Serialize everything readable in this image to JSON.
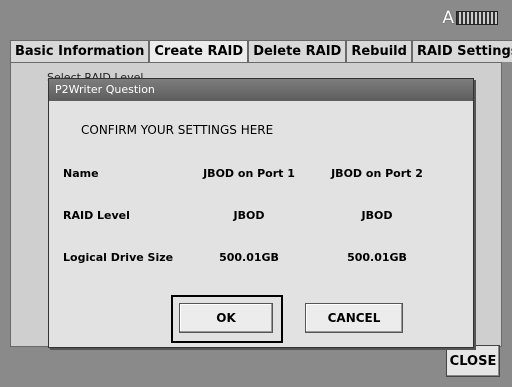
{
  "header": {
    "indicator_letter": "A",
    "battery_icon": "battery-icon"
  },
  "tabs": [
    {
      "label": "Basic Information"
    },
    {
      "label": "Create RAID"
    },
    {
      "label": "Delete RAID"
    },
    {
      "label": "Rebuild"
    },
    {
      "label": "RAID Settings"
    }
  ],
  "panel": {
    "behind_text": "Select RAID Level"
  },
  "dialog": {
    "title": "P2Writer Question",
    "heading": "CONFIRM YOUR SETTINGS HERE",
    "rows": [
      {
        "label": "Name",
        "col1": "JBOD on Port 1",
        "col2": "JBOD on Port 2"
      },
      {
        "label": "RAID Level",
        "col1": "JBOD",
        "col2": "JBOD"
      },
      {
        "label": "Logical Drive Size",
        "col1": "500.01GB",
        "col2": "500.01GB"
      }
    ],
    "ok_label": "OK",
    "cancel_label": "CANCEL"
  },
  "close_label": "CLOSE"
}
